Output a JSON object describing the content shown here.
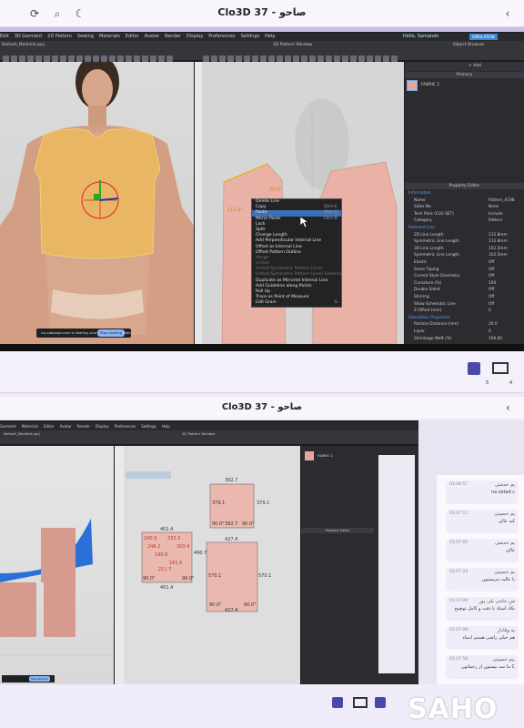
{
  "top_bar": {
    "title": "Clo3D 37 - صاحو"
  },
  "bottom_bar": {
    "title": "Clo3D 37 - صاحو"
  },
  "clo_menu": [
    "Edit",
    "3D Garment",
    "2D Pattern",
    "Sewing",
    "Materials",
    "Editor",
    "Avatar",
    "Render",
    "Display",
    "Preferences",
    "Settings",
    "Help"
  ],
  "clo_menu_small": [
    "Garment",
    "Materials",
    "Editor",
    "Avatar",
    "Render",
    "Display",
    "Preferences",
    "Settings",
    "Help"
  ],
  "user": "Hello, Samaneh",
  "simulation_badge": "SIMULATION",
  "tab_3d": "Default_Modelist.zprj",
  "pattern_window_title": "2D Pattern Window",
  "object_browser": {
    "title": "Object Browser",
    "add_label": "+ Add",
    "primary_label": "Primary",
    "item": "FABRIC 1"
  },
  "property_editor": {
    "title": "Property Editor",
    "rows": [
      {
        "k": "Information",
        "v": "",
        "sec": true
      },
      {
        "k": "Name",
        "v": "Pattern_6198"
      },
      {
        "k": "Sides No",
        "v": "None"
      },
      {
        "k": "Tech Pack (CLO-SET)",
        "v": "Include"
      },
      {
        "k": "Category",
        "v": "Pattern"
      },
      {
        "k": "Selected Line",
        "v": "",
        "sec": true
      },
      {
        "k": "2D Line Length",
        "v": "112.8mm"
      },
      {
        "k": "Symmetric Line Length",
        "v": "112.8mm"
      },
      {
        "k": "3D Line Length",
        "v": "102.5mm"
      },
      {
        "k": "Symmetric Line Length",
        "v": "102.5mm"
      },
      {
        "k": "Elastic",
        "v": "Off"
      },
      {
        "k": "Seam Taping",
        "v": "Off"
      },
      {
        "k": "Curved Style Geometry",
        "v": "Off"
      },
      {
        "k": "Curvature (%)",
        "v": "100"
      },
      {
        "k": "Double Sided",
        "v": "Off"
      },
      {
        "k": "Shirring",
        "v": "Off"
      },
      {
        "k": "Show Schematic Line",
        "v": "Off"
      },
      {
        "k": "Z-Offset (mm)",
        "v": "0"
      },
      {
        "k": "Simulation Properties",
        "v": "",
        "sec": true
      },
      {
        "k": "Particle Distance (mm)",
        "v": "20.0"
      },
      {
        "k": "Layer",
        "v": "0"
      },
      {
        "k": "Shrinkage Weft (%)",
        "v": "100.00"
      }
    ]
  },
  "context_menu": [
    {
      "label": "Delete Line",
      "shortcut": ""
    },
    {
      "label": "Copy",
      "shortcut": "Ctrl+C"
    },
    {
      "label": "Paste",
      "shortcut": "Ctrl+V",
      "highlight": true
    },
    {
      "label": "Mirror Paste",
      "shortcut": "Ctrl+R"
    },
    {
      "label": "Lock",
      "shortcut": ""
    },
    {
      "label": "Split",
      "shortcut": ""
    },
    {
      "label": "Change Length",
      "shortcut": ""
    },
    {
      "label": "Add Perpendicular Internal Line",
      "shortcut": ""
    },
    {
      "label": "Offset as Internal Line",
      "shortcut": ""
    },
    {
      "label": "Offset Pattern Outline",
      "shortcut": ""
    },
    {
      "label": "Merge",
      "shortcut": "",
      "disabled": true
    },
    {
      "label": "Unfold",
      "shortcut": "",
      "disabled": true
    },
    {
      "label": "Unfold Symmetric Pattern (Line)",
      "shortcut": "",
      "disabled": true
    },
    {
      "label": "Unfold Symmetric Pattern (Line) Seaming",
      "shortcut": "",
      "disabled": true
    },
    {
      "label": "Duplicate as Mirrored Internal Line",
      "shortcut": ""
    },
    {
      "label": "Add Guideline along Points",
      "shortcut": ""
    },
    {
      "label": "Roll Up",
      "shortcut": ""
    },
    {
      "label": "Trace as Point of Measure",
      "shortcut": ""
    },
    {
      "label": "Edit Grain",
      "shortcut": "G"
    }
  ],
  "pattern_labels_top": [
    "70.0°",
    "111.3°"
  ],
  "share_banner": "clo.zaboolpt.com is sharing your screen.",
  "stop_sharing": "Stop sharing",
  "hide": "Hide",
  "taskbar_num": [
    "5",
    "4"
  ],
  "bottom_patterns": {
    "top_small": [
      "392.7",
      "379.1",
      "379.1",
      "392.7",
      "90.0°",
      "90.0°"
    ],
    "bottom_right": [
      "427.4",
      "570.1",
      "570.1",
      "427.4",
      "90.0°",
      "90.0°"
    ],
    "left_piece": [
      "401.4",
      "240.9",
      "233.3",
      "248.2",
      "303.4",
      "490.7",
      "190.8",
      "161.6",
      "211.7",
      "401.4",
      "90.0°",
      "90.0°"
    ]
  },
  "chat": [
    {
      "name": "یم خدمتی",
      "time": "01:06:57",
      "text": "na ostad c"
    },
    {
      "name": "یم حسینی",
      "time": "01:07:11",
      "text": "کیه عالی"
    },
    {
      "name": "یم خدمتی",
      "time": "01:07:05",
      "text": "عالی"
    },
    {
      "name": "یم حسینی",
      "time": "01:07:24",
      "text": "با عالیه دیزیستون"
    },
    {
      "name": "من حاجی بلی پور",
      "time": "01:07:06",
      "text": "نکاد استاد با دقت و کامل توضیح"
    },
    {
      "name": "یه وقادار",
      "time": "01:07:08",
      "text": "هم خیلی راضی هستم استاد"
    },
    {
      "name": "بیم حسینی",
      "time": "01:07:58",
      "text": "ما سه بیستون از زحماتون C"
    }
  ],
  "watermark": "SAHO"
}
